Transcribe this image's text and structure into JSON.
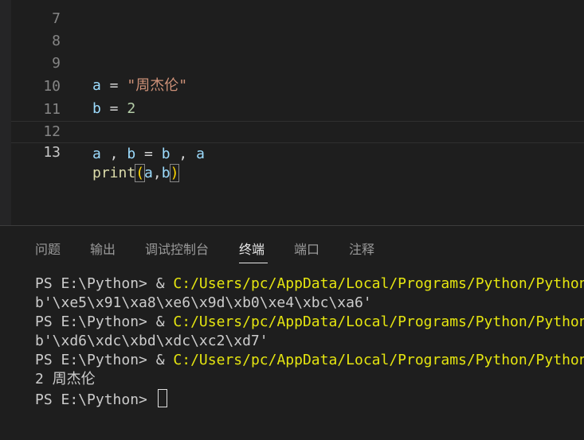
{
  "editor": {
    "partial_line_number": "7",
    "lines": [
      {
        "number": "8",
        "code": ""
      },
      {
        "number": "9",
        "var": "a",
        "eq": " = ",
        "str": "\"周杰伦\""
      },
      {
        "number": "10",
        "var": "b",
        "eq": " = ",
        "num": "2"
      },
      {
        "number": "11",
        "code": ""
      },
      {
        "number": "12",
        "a1": "a",
        "s1": " , ",
        "b1": "b",
        "s2": " = ",
        "b2": "b",
        "s3": " , ",
        "a2": "a"
      },
      {
        "number": "13",
        "fn": "print",
        "lp": "(",
        "a": "a",
        "comma": ",",
        "b": "b",
        "rp": ")"
      }
    ]
  },
  "panel": {
    "tabs": [
      "问题",
      "输出",
      "调试控制台",
      "终端",
      "端口",
      "注释"
    ],
    "active_tab": "终端"
  },
  "terminal": {
    "prompt": "PS E:\\Python> ",
    "amp": "& ",
    "path": "C:/Users/pc/AppData/Local/Programs/Python/Python",
    "out1": "b'\\xe5\\x91\\xa8\\xe6\\x9d\\xb0\\xe4\\xbc\\xa6'",
    "out2": "b'\\xd6\\xdc\\xbd\\xdc\\xc2\\xd7'",
    "out3": "2 周杰伦"
  }
}
